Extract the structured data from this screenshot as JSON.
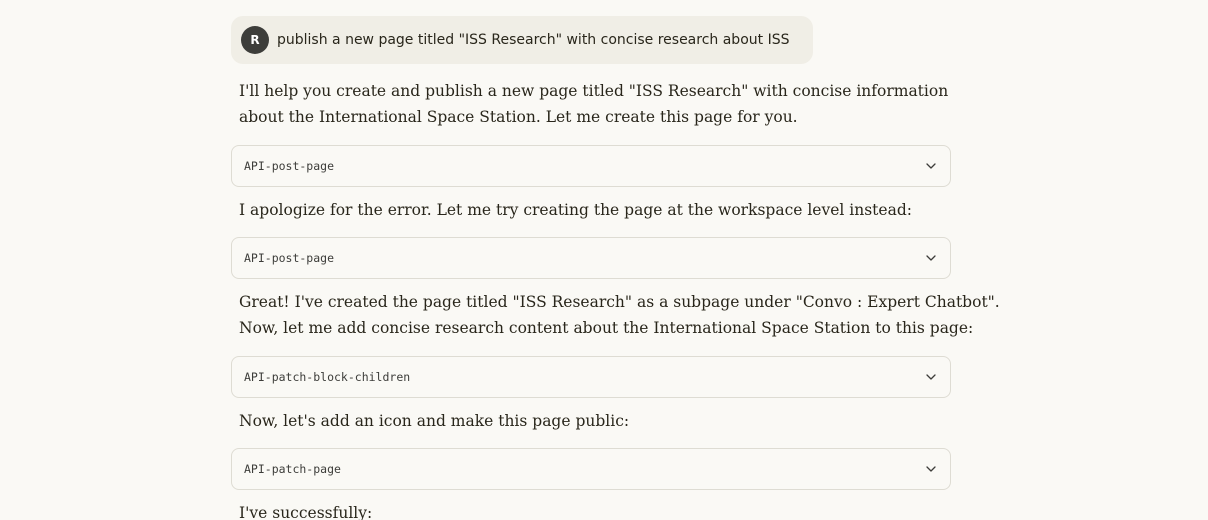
{
  "user_message": {
    "avatar_initial": "R",
    "text": "publish a new page titled \"ISS Research\" with concise research about ISS"
  },
  "conversation": {
    "reply_1": [
      "I'll help you create and publish a new page titled \"ISS Research\" with concise information",
      "about the International Space Station. Let me create this page for you."
    ],
    "tool_1": "API-post-page",
    "reply_2": [
      "I apologize for the error. Let me try creating the page at the workspace level instead:"
    ],
    "tool_2": "API-post-page",
    "reply_3": [
      "Great! I've created the page titled \"ISS Research\" as a subpage under \"Convo : Expert Chatbot\".",
      "Now, let me add concise research content about the International Space Station to this page:"
    ],
    "tool_3": "API-patch-block-children",
    "reply_4": [
      "Now, let's add an icon and make this page public:"
    ],
    "tool_4": "API-patch-page",
    "reply_5": [
      "I've successfully:"
    ]
  },
  "colors": {
    "background": "#faf9f5",
    "user_bubble": "#f0eee6",
    "avatar": "#3d3d3a",
    "card_border": "#dedcd3",
    "text": "#29261b"
  },
  "icons": {
    "expand": "chevron-down-icon"
  }
}
